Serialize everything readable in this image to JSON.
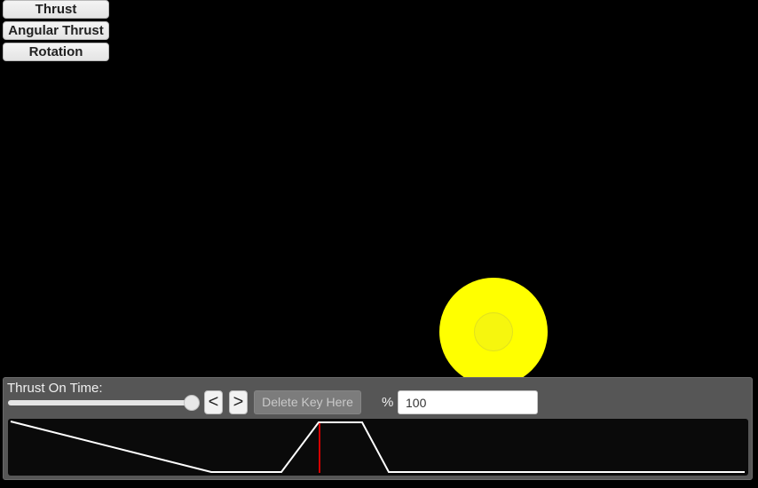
{
  "mode_buttons": {
    "thrust": "Thrust",
    "angular_thrust": "Angular Thrust",
    "rotation": "Rotation"
  },
  "panel": {
    "label": "Thrust On Time:",
    "prev_label": "<",
    "next_label": ">",
    "delete_label": "Delete Key Here",
    "percent_label": "%",
    "percent_value": "100"
  },
  "colors": {
    "ship": "#ffff00",
    "curve": "#ffffff",
    "cursor": "#d40000"
  }
}
